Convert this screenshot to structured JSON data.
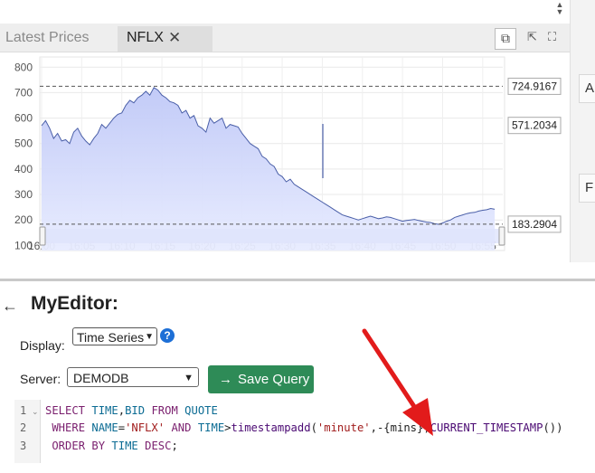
{
  "top": {
    "scroll_up": "▲",
    "scroll_down": "▼"
  },
  "tabs": [
    {
      "label": "Latest Prices",
      "active": false
    },
    {
      "label": "NFLX",
      "active": true,
      "close": "✕"
    }
  ],
  "window_controls": {
    "popout_icon": "popout-icon",
    "newwindow_icon": "new-window-icon",
    "maximize_icon": "maximize-icon"
  },
  "side_panel": {
    "items": [
      "A",
      "F"
    ]
  },
  "chart_data": {
    "type": "area",
    "y_ticks": [
      800,
      700,
      600,
      500,
      400,
      300,
      200,
      100
    ],
    "x_ticks": [
      "16:00",
      "16:05",
      "16:10",
      "16:15",
      "16:20",
      "16:25",
      "16:30",
      "16:35",
      "16:40",
      "16:45",
      "16:50",
      "16:55"
    ],
    "ylim": [
      80,
      840
    ],
    "reference_lines": [
      724.9167,
      183.2904
    ],
    "last_value": 571.2034,
    "price_labels": [
      "724.9167",
      "571.2034",
      "183.2904"
    ],
    "series": [
      {
        "x_minutes": [
          0,
          0.5,
          1,
          1.5,
          2,
          2.5,
          3,
          3.5,
          4,
          4.5,
          5,
          5.5,
          6,
          6.5,
          7,
          7.5,
          8,
          8.5,
          9,
          9.5,
          10,
          10.5,
          11,
          11.5,
          12,
          12.5,
          13,
          13.5,
          14,
          14.5,
          15,
          15.5,
          16,
          16.5,
          17,
          17.5,
          18,
          18.5,
          19,
          19.5,
          20,
          20.5,
          21,
          21.5,
          22,
          22.5,
          23,
          23.5,
          24,
          24.5,
          25,
          25.5,
          26,
          26.5,
          27,
          27.5,
          28,
          28.5,
          29,
          29.5,
          30,
          30.5,
          31,
          31.5,
          32,
          32.5,
          33,
          33.5,
          34,
          34.5,
          35,
          35.5,
          36,
          36.5,
          37,
          37.5,
          38,
          38.5,
          39,
          39.5,
          40,
          40.5,
          41,
          41.5,
          42,
          42.5,
          43,
          43.5,
          44,
          44.5,
          45,
          45.5,
          46,
          46.5,
          47,
          47.5,
          48,
          48.5,
          49,
          49.5,
          50,
          50.5,
          51,
          51.5,
          52,
          52.5,
          53,
          53.5,
          54,
          54.5,
          55,
          55.5,
          56,
          56.5
        ],
        "values": [
          570,
          590,
          560,
          520,
          540,
          510,
          515,
          500,
          545,
          560,
          530,
          510,
          495,
          520,
          540,
          575,
          560,
          580,
          600,
          615,
          620,
          650,
          670,
          660,
          680,
          690,
          705,
          690,
          720,
          710,
          690,
          680,
          665,
          660,
          650,
          620,
          630,
          600,
          610,
          570,
          560,
          545,
          600,
          580,
          590,
          600,
          560,
          575,
          570,
          565,
          540,
          520,
          500,
          490,
          480,
          450,
          440,
          420,
          410,
          380,
          370,
          350,
          360,
          340,
          330,
          320,
          310,
          300,
          290,
          280,
          270,
          260,
          250,
          240,
          230,
          220,
          215,
          210,
          205,
          200,
          205,
          210,
          215,
          210,
          205,
          208,
          212,
          210,
          205,
          200,
          195,
          198,
          200,
          202,
          198,
          195,
          192,
          190,
          185,
          183,
          188,
          195,
          200,
          210,
          215,
          220,
          225,
          228,
          230,
          235,
          238,
          240,
          245,
          242
        ]
      }
    ]
  },
  "editor": {
    "back_icon": "←",
    "title": "MyEditor:",
    "display_label": "Display:",
    "display_value": "Time Series",
    "help": "?",
    "server_label": "Server:",
    "server_value": "DEMODB",
    "save_label": "Save Query",
    "save_arrow": "→",
    "line_numbers": [
      "1",
      "2",
      "3"
    ],
    "code_lines": [
      "SELECT TIME,BID FROM QUOTE",
      " WHERE NAME='NFLX' AND TIME>timestampadd('minute',-{mins},CURRENT_TIMESTAMP())",
      " ORDER BY TIME DESC;"
    ]
  },
  "colors": {
    "accent_green": "#2e8b57",
    "line": "#4a5fa8",
    "fill": "#c8d0f5",
    "arrow": "#e21b1b"
  }
}
